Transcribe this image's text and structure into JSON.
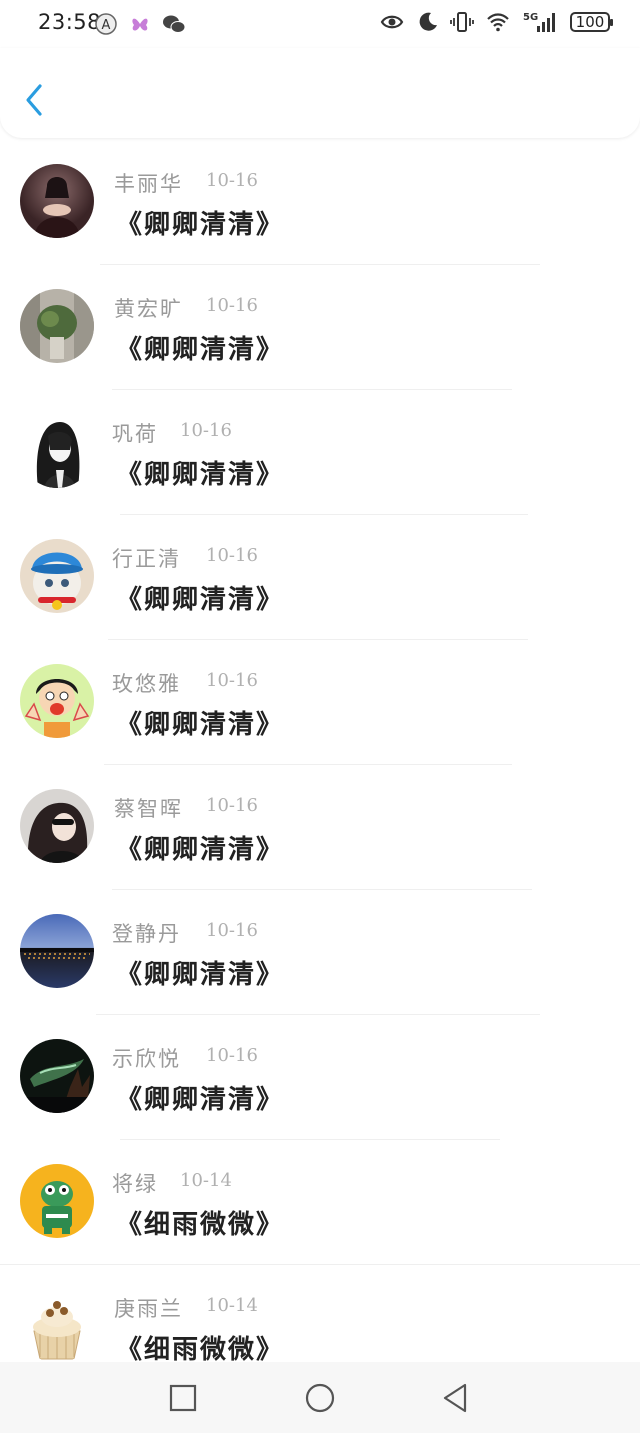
{
  "status": {
    "time": "23:58",
    "battery": "100",
    "network": "5G"
  },
  "list": [
    {
      "name": "丰丽华",
      "date": "10-16",
      "title": "《卿卿清清》",
      "avatar": "woman-portrait"
    },
    {
      "name": "黄宏旷",
      "date": "10-16",
      "title": "《卿卿清清》",
      "avatar": "plant-vase"
    },
    {
      "name": "巩荷",
      "date": "10-16",
      "title": "《卿卿清清》",
      "avatar": "anime-sketch"
    },
    {
      "name": "行正清",
      "date": "10-16",
      "title": "《卿卿清清》",
      "avatar": "cat-hat"
    },
    {
      "name": "玫悠雅",
      "date": "10-16",
      "title": "《卿卿清清》",
      "avatar": "cartoon-girl"
    },
    {
      "name": "蔡智晖",
      "date": "10-16",
      "title": "《卿卿清清》",
      "avatar": "woman-sunglasses"
    },
    {
      "name": "登静丹",
      "date": "10-16",
      "title": "《卿卿清清》",
      "avatar": "lake-night"
    },
    {
      "name": "示欣悦",
      "date": "10-16",
      "title": "《卿卿清清》",
      "avatar": "aurora-sky"
    },
    {
      "name": "将绿",
      "date": "10-14",
      "title": "《细雨微微》",
      "avatar": "cartoon-frog"
    },
    {
      "name": "庚雨兰",
      "date": "10-14",
      "title": "《细雨微微》",
      "avatar": "cupcake"
    }
  ]
}
